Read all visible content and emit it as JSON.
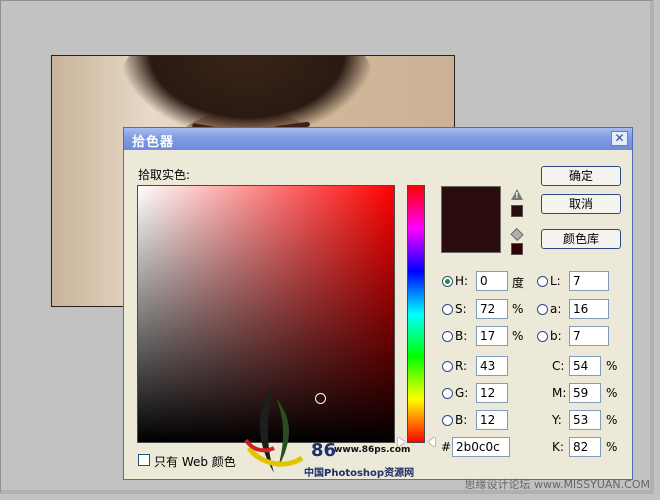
{
  "dialog": {
    "title": "拾色器",
    "close_glyph": "✕",
    "pick_label": "拾取实色:",
    "buttons": {
      "ok": "确定",
      "cancel": "取消",
      "libraries": "颜色库"
    },
    "web_only_label": "只有 Web 颜色",
    "hsb": {
      "h": {
        "label": "H:",
        "value": "0",
        "unit": "度",
        "selected": true
      },
      "s": {
        "label": "S:",
        "value": "72",
        "unit": "%"
      },
      "b": {
        "label": "B:",
        "value": "17",
        "unit": "%"
      }
    },
    "rgb": {
      "r": {
        "label": "R:",
        "value": "43"
      },
      "g": {
        "label": "G:",
        "value": "12"
      },
      "b": {
        "label": "B:",
        "value": "12"
      }
    },
    "lab": {
      "l": {
        "label": "L:",
        "value": "7"
      },
      "a": {
        "label": "a:",
        "value": "16"
      },
      "b": {
        "label": "b:",
        "value": "7"
      }
    },
    "cmyk": {
      "c": {
        "label": "C:",
        "value": "54",
        "unit": "%"
      },
      "m": {
        "label": "M:",
        "value": "59",
        "unit": "%"
      },
      "y": {
        "label": "Y:",
        "value": "53",
        "unit": "%"
      },
      "k": {
        "label": "K:",
        "value": "82",
        "unit": "%"
      }
    },
    "hex": {
      "label": "#",
      "value": "2b0c0c"
    },
    "current_color": "#2b0c0c",
    "gamut_swatch_color": "#2b0c0c",
    "web_swatch_color": "#330000",
    "icons": {
      "gamut_warning": "warning-triangle-icon",
      "web_safe": "cube-icon"
    }
  },
  "watermark": {
    "logo_number": "86",
    "url": "www.86ps.com",
    "site_name": "中国Photoshop资源网",
    "bottom_right": "思缘设计论坛 www.MISSYUAN.COM"
  }
}
